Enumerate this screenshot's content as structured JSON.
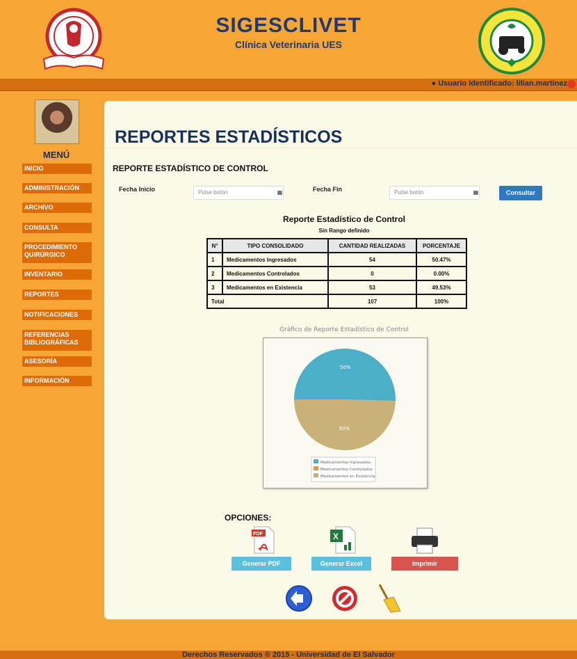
{
  "header": {
    "title": "SIGESCLIVET",
    "subtitle": "Clínica Veterinaria UES"
  },
  "user": {
    "label": "Usuario Identificado: lilian.martinez"
  },
  "sidebar": {
    "menu_title": "MENÚ",
    "items": [
      "INICIO",
      "ADMINISTRACIÓN",
      "ARCHIVO",
      "CONSULTA",
      "PROCEDIMIENTO QUIRÚRGICO",
      "INVENTARIO",
      "REPORTES",
      "NOTIFICACIONES",
      "REFERENCIAS BIBLIOGRÁFICAS",
      "ASESORÍA",
      "INFORMACIÓN"
    ]
  },
  "main": {
    "page_title": "REPORTES ESTADÍSTICOS",
    "section_title": "REPORTE ESTADÍSTICO DE CONTROL",
    "filters": {
      "start_label": "Fecha Inicio",
      "start_placeholder": "Pulse botón",
      "end_label": "Fecha Fin",
      "end_placeholder": "Pulse botón",
      "consult_label": "Consultar"
    },
    "report": {
      "title": "Reporte Estadístico de Control",
      "subtitle": "Sin Rango definido",
      "headers": [
        "N°",
        "TIPO CONSOLIDADO",
        "CANTIDAD REALIZADAS",
        "PORCENTAJE"
      ],
      "rows": [
        [
          "1",
          "Medicamentos Ingresados",
          "54",
          "50.47%"
        ],
        [
          "2",
          "Medicamentos Controlados",
          "0",
          "0.00%"
        ],
        [
          "3",
          "Medicamentos en Existencia",
          "53",
          "49.53%"
        ]
      ],
      "total": [
        "Total",
        "107",
        "100%"
      ]
    },
    "chart_title": "Gráfico de Reporte Estadístico de Control",
    "options_title": "OPCIONES:",
    "buttons": {
      "pdf": "Generar PDF",
      "excel": "Generar Excel",
      "print": "Imprimir"
    }
  },
  "chart_data": {
    "type": "pie",
    "title": "Gráfico de Reporte Estadístico de Control",
    "categories": [
      "Medicamentos Ingresados",
      "Medicamentos Controlados",
      "Medicamentos en Existencia"
    ],
    "values": [
      54,
      0,
      53
    ],
    "slice_labels": [
      "50%",
      "",
      "50%"
    ],
    "colors": [
      "#4aafc7",
      "#e8962f",
      "#c8b27a"
    ],
    "legend": "bottom-center"
  },
  "footer": {
    "text": "Derechos Reservados ® 2015 - Universidad de El Salvador"
  },
  "icons": {
    "pdf": "pdf-file-icon",
    "excel": "excel-file-icon",
    "print": "printer-icon",
    "back": "back-arrow-icon",
    "cancel": "cancel-icon",
    "clean": "broom-icon"
  }
}
